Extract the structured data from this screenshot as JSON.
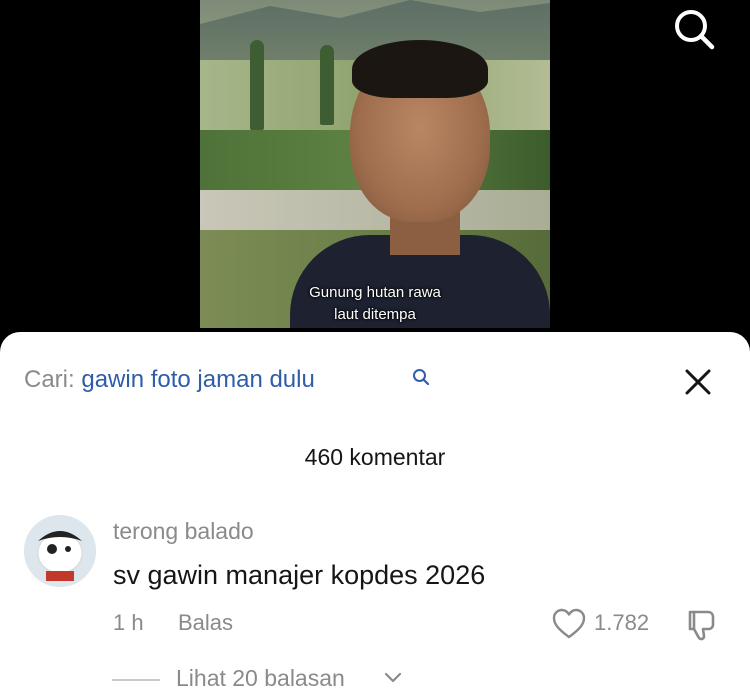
{
  "video": {
    "caption_line1": "Gunung hutan rawa",
    "caption_line2": "laut ditempa"
  },
  "top_bar": {
    "search_icon": "search-icon"
  },
  "comments_sheet": {
    "search_prefix": "Cari:",
    "search_query": "gawin foto jaman dulu",
    "search_query_icon": "search-icon",
    "close_icon": "close-icon",
    "count_label": "460 komentar",
    "comment": {
      "username": "terong balado",
      "text": "sv gawin manajer kopdes 2026",
      "time": "1 h",
      "reply_label": "Balas",
      "like_count": "1.782",
      "view_replies": "Lihat 20 balasan"
    }
  },
  "colors": {
    "query_link": "#2f5da9",
    "muted_text": "#8a8a8a",
    "primary_text": "#161616"
  }
}
